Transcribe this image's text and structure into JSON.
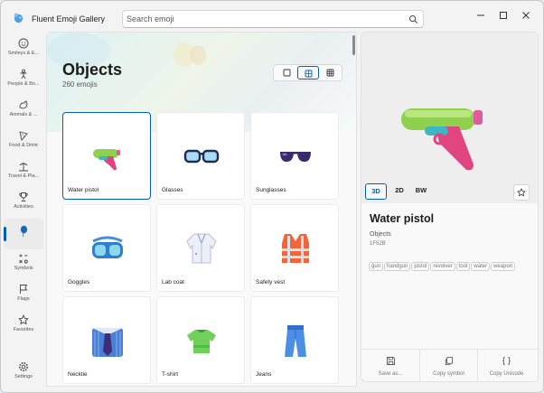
{
  "app": {
    "title": "Fluent Emoji Gallery"
  },
  "search": {
    "placeholder": "Search emoji"
  },
  "nav": {
    "items": [
      {
        "label": "Smileys & E...",
        "icon": "smiley-icon"
      },
      {
        "label": "People & Bo...",
        "icon": "person-icon"
      },
      {
        "label": "Animals & ...",
        "icon": "animal-icon"
      },
      {
        "label": "Food & Drink",
        "icon": "food-icon"
      },
      {
        "label": "Travel & Pla...",
        "icon": "travel-icon"
      },
      {
        "label": "Activities",
        "icon": "trophy-icon"
      },
      {
        "label": "",
        "icon": "balloon-icon"
      },
      {
        "label": "Symbols",
        "icon": "symbols-icon"
      },
      {
        "label": "Flags",
        "icon": "flag-icon"
      },
      {
        "label": "Favorites",
        "icon": "star-icon"
      }
    ],
    "settings_label": "Settings"
  },
  "page": {
    "title": "Objects",
    "count": "260 emojis"
  },
  "grid": {
    "items": [
      {
        "label": "Water pistol"
      },
      {
        "label": "Glasses"
      },
      {
        "label": "Sunglasses"
      },
      {
        "label": "Goggles"
      },
      {
        "label": "Lab coat"
      },
      {
        "label": "Safety vest"
      },
      {
        "label": "Necktie"
      },
      {
        "label": "T-shirt"
      },
      {
        "label": "Jeans"
      }
    ]
  },
  "details": {
    "name": "Water pistol",
    "group": "Objects",
    "code": "1F52B",
    "keywords": [
      "gun",
      "handgun",
      "pistol",
      "revolver",
      "tool",
      "water",
      "weapon"
    ],
    "styles": [
      "3D",
      "2D",
      "BW"
    ],
    "actions": {
      "save": "Save as...",
      "copy_symbol": "Copy symbol",
      "copy_unicode": "Copy Unicode"
    }
  },
  "colors": {
    "accent": "#005fb8"
  }
}
